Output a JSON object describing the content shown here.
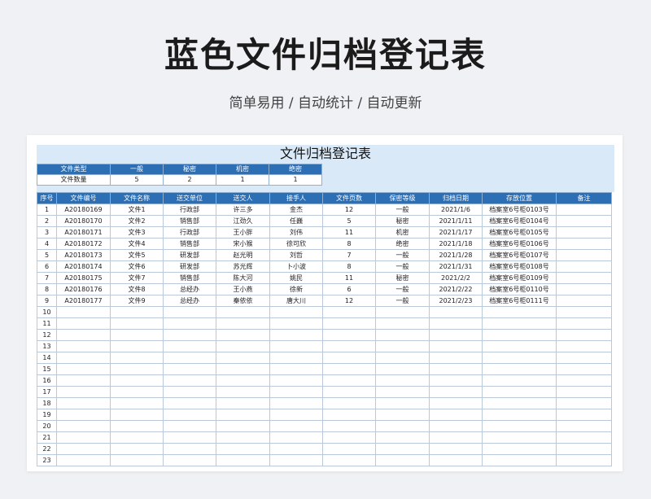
{
  "header": {
    "title": "蓝色文件归档登记表",
    "subtitle": "简单易用 / 自动统计 / 自动更新"
  },
  "sheet": {
    "title": "文件归档登记表",
    "summary": {
      "label_type": "文件类型",
      "label_count": "文件数量",
      "types": [
        "一般",
        "秘密",
        "机密",
        "绝密"
      ],
      "counts": [
        "5",
        "2",
        "1",
        "1"
      ]
    },
    "columns": [
      "序号",
      "文件编号",
      "文件名称",
      "送交单位",
      "送交人",
      "接手人",
      "文件页数",
      "保密等级",
      "归档日期",
      "存放位置",
      "备注"
    ],
    "rows": [
      [
        "1",
        "A20180169",
        "文件1",
        "行政部",
        "许三多",
        "金杰",
        "12",
        "一般",
        "2021/1/6",
        "档案室6号柜0103号",
        ""
      ],
      [
        "2",
        "A20180170",
        "文件2",
        "销售部",
        "江劲久",
        "任巍",
        "5",
        "秘密",
        "2021/1/11",
        "档案室6号柜0104号",
        ""
      ],
      [
        "3",
        "A20180171",
        "文件3",
        "行政部",
        "王小胖",
        "刘伟",
        "11",
        "机密",
        "2021/1/17",
        "档案室6号柜0105号",
        ""
      ],
      [
        "4",
        "A20180172",
        "文件4",
        "销售部",
        "宋小猴",
        "徐可欣",
        "8",
        "绝密",
        "2021/1/18",
        "档案室6号柜0106号",
        ""
      ],
      [
        "5",
        "A20180173",
        "文件5",
        "研发部",
        "赵光明",
        "刘哲",
        "7",
        "一般",
        "2021/1/28",
        "档案室6号柜0107号",
        ""
      ],
      [
        "6",
        "A20180174",
        "文件6",
        "研发部",
        "苏光辉",
        "卜小波",
        "8",
        "一般",
        "2021/1/31",
        "档案室6号柜0108号",
        ""
      ],
      [
        "7",
        "A20180175",
        "文件7",
        "销售部",
        "陈大河",
        "姚民",
        "11",
        "秘密",
        "2021/2/2",
        "档案室6号柜0109号",
        ""
      ],
      [
        "8",
        "A20180176",
        "文件8",
        "总经办",
        "王小燕",
        "徐新",
        "6",
        "一般",
        "2021/2/22",
        "档案室6号柜0110号",
        ""
      ],
      [
        "9",
        "A20180177",
        "文件9",
        "总经办",
        "秦依依",
        "唐大川",
        "12",
        "一般",
        "2021/2/23",
        "档案室6号柜0111号",
        ""
      ],
      [
        "10",
        "",
        "",
        "",
        "",
        "",
        "",
        "",
        "",
        "",
        ""
      ],
      [
        "11",
        "",
        "",
        "",
        "",
        "",
        "",
        "",
        "",
        "",
        ""
      ],
      [
        "12",
        "",
        "",
        "",
        "",
        "",
        "",
        "",
        "",
        "",
        ""
      ],
      [
        "13",
        "",
        "",
        "",
        "",
        "",
        "",
        "",
        "",
        "",
        ""
      ],
      [
        "14",
        "",
        "",
        "",
        "",
        "",
        "",
        "",
        "",
        "",
        ""
      ],
      [
        "15",
        "",
        "",
        "",
        "",
        "",
        "",
        "",
        "",
        "",
        ""
      ],
      [
        "16",
        "",
        "",
        "",
        "",
        "",
        "",
        "",
        "",
        "",
        ""
      ],
      [
        "17",
        "",
        "",
        "",
        "",
        "",
        "",
        "",
        "",
        "",
        ""
      ],
      [
        "18",
        "",
        "",
        "",
        "",
        "",
        "",
        "",
        "",
        "",
        ""
      ],
      [
        "19",
        "",
        "",
        "",
        "",
        "",
        "",
        "",
        "",
        "",
        ""
      ],
      [
        "20",
        "",
        "",
        "",
        "",
        "",
        "",
        "",
        "",
        "",
        ""
      ],
      [
        "21",
        "",
        "",
        "",
        "",
        "",
        "",
        "",
        "",
        "",
        ""
      ],
      [
        "22",
        "",
        "",
        "",
        "",
        "",
        "",
        "",
        "",
        "",
        ""
      ],
      [
        "23",
        "",
        "",
        "",
        "",
        "",
        "",
        "",
        "",
        "",
        ""
      ]
    ]
  }
}
